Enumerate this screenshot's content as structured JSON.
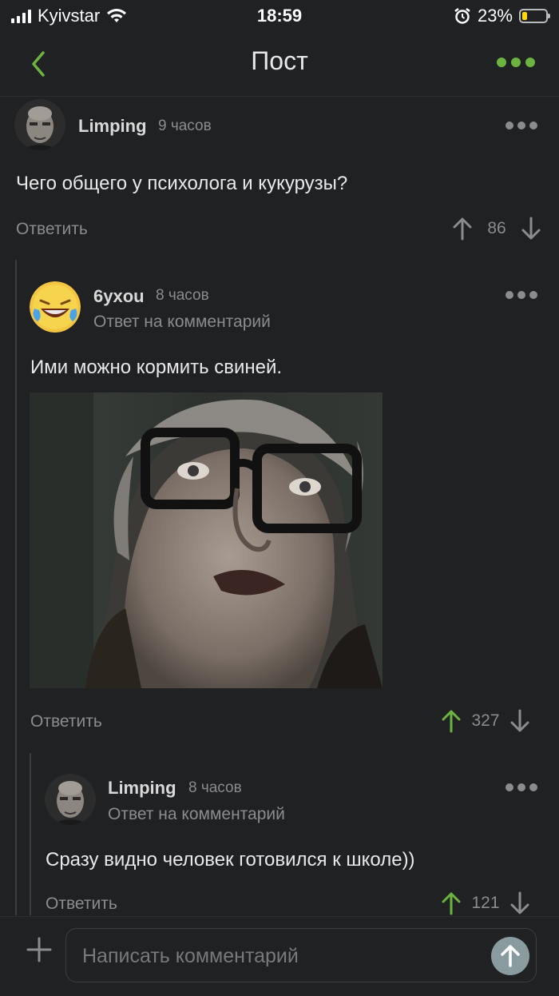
{
  "status_bar": {
    "carrier": "Kyivstar",
    "time": "18:59",
    "battery": "23%",
    "battery_level": 0.23,
    "icons": [
      "signal-icon",
      "wifi-icon",
      "alarm-icon",
      "battery-icon"
    ]
  },
  "nav": {
    "title": "Пост",
    "back_icon": "chevron-left-icon",
    "more_icon": "more-dots-icon"
  },
  "colors": {
    "background": "#1f2123",
    "accent_green": "#6cb33f",
    "muted_text": "#8a8c8e"
  },
  "comments": [
    {
      "user": "Limping",
      "time": "9 часов",
      "text": "Чего общего у психолога и кукурузы?",
      "reply_label": "Ответить",
      "score": "86",
      "upvoted": false
    },
    {
      "user": "6yxou",
      "time": "8 часов",
      "subtitle": "Ответ на комментарий",
      "text": "Ими можно кормить свиней.",
      "has_image": true,
      "reply_label": "Ответить",
      "score": "327",
      "upvoted": true
    },
    {
      "user": "Limping",
      "time": "8 часов",
      "subtitle": "Ответ на комментарий",
      "text": "Сразу видно человек готовился к школе))",
      "reply_label": "Ответить",
      "score": "121",
      "upvoted": true
    }
  ],
  "composer": {
    "placeholder": "Написать комментарий",
    "value": "",
    "add_icon": "plus-icon",
    "send_icon": "send-arrow-icon"
  }
}
